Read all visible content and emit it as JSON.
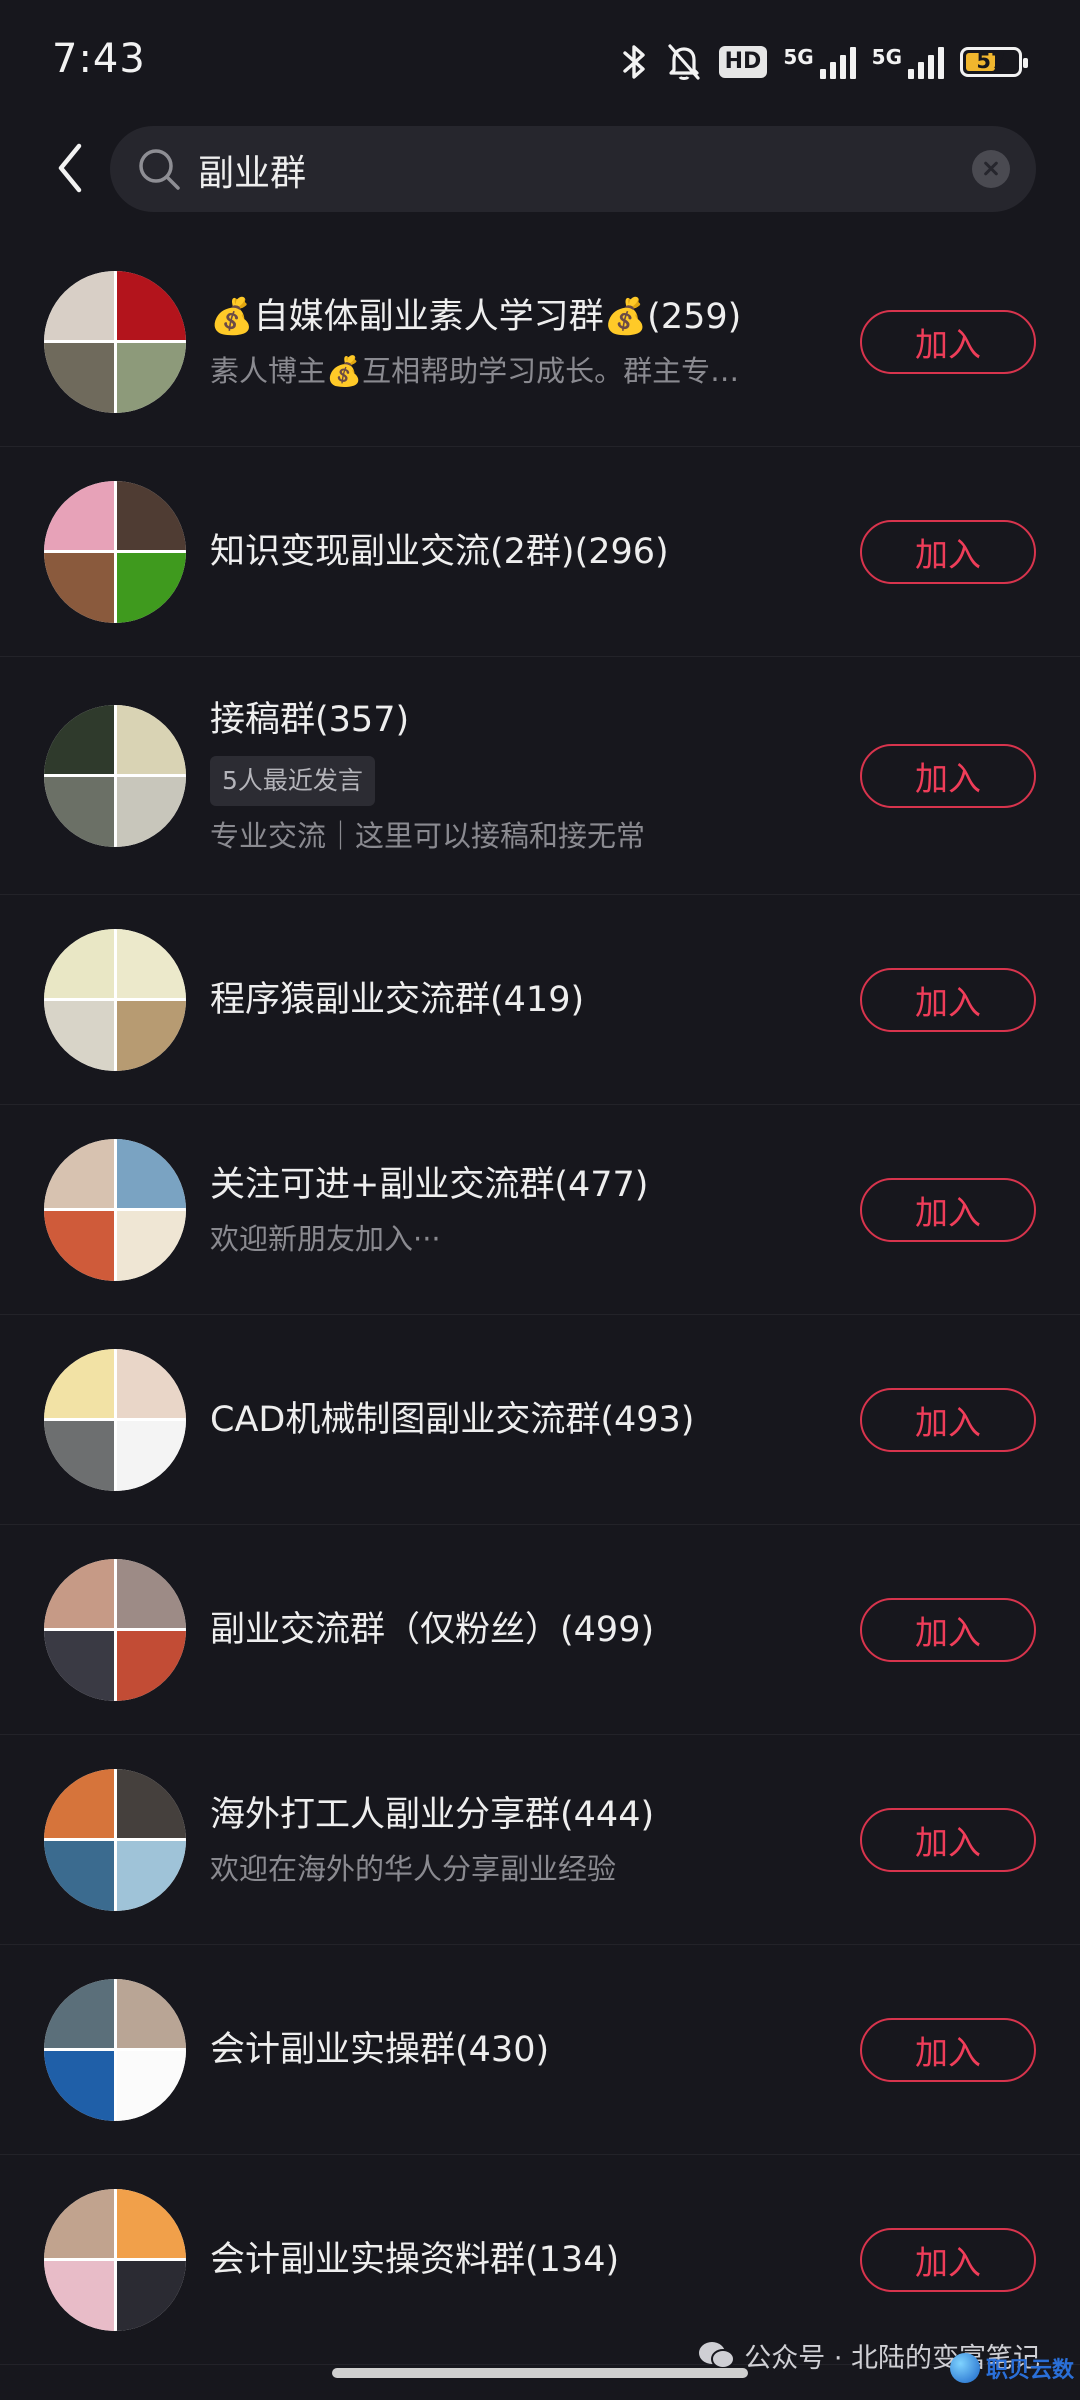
{
  "status_bar": {
    "time": "7:43",
    "network_1": "5G",
    "network_2": "5G",
    "hd_label": "HD",
    "battery": "57",
    "battery_level": 0.57
  },
  "search": {
    "query": "副业群"
  },
  "groups": [
    {
      "title": "💰自媒体副业素人学习群💰(259)",
      "desc": "素人博主💰互相帮助学习成长。群主专…",
      "tag": "",
      "join": "加入",
      "avatar_colors": [
        "#d8cfc6",
        "#b3141c",
        "#6f6a5c",
        "#8d9a7a"
      ]
    },
    {
      "title": "知识变现副业交流(2群)(296)",
      "desc": "",
      "tag": "",
      "join": "加入",
      "avatar_colors": [
        "#e7a2b8",
        "#4f3c33",
        "#8a5a3d",
        "#3f9a1e"
      ]
    },
    {
      "title": "接稿群(357)",
      "tag": "5人最近发言",
      "desc": "专业交流｜这里可以接稿和接无常",
      "join": "加入",
      "avatar_colors": [
        "#2f3a2c",
        "#d9d3b4",
        "#6b7066",
        "#c8c6bb"
      ]
    },
    {
      "title": "程序猿副业交流群(419)",
      "desc": "",
      "tag": "",
      "join": "加入",
      "avatar_colors": [
        "#e9e7c5",
        "#ece9cb",
        "#d8d4c8",
        "#b79b72"
      ]
    },
    {
      "title": "关注可进+副业交流群(477)",
      "desc": "欢迎新朋友加入···",
      "tag": "",
      "join": "加入",
      "avatar_colors": [
        "#d7c2b0",
        "#7aa3c2",
        "#cf5b3a",
        "#efe6d4"
      ]
    },
    {
      "title": "CAD机械制图副业交流群(493)",
      "desc": "",
      "tag": "",
      "join": "加入",
      "avatar_colors": [
        "#f2e2a5",
        "#e9d6c8",
        "#6d6f70",
        "#f4f4f4"
      ]
    },
    {
      "title": "副业交流群（仅粉丝）(499)",
      "desc": "",
      "tag": "",
      "join": "加入",
      "avatar_colors": [
        "#c69a86",
        "#9d8b86",
        "#3a3a44",
        "#c24c35"
      ]
    },
    {
      "title": "海外打工人副业分享群(444)",
      "desc": "欢迎在海外的华人分享副业经验",
      "tag": "",
      "join": "加入",
      "avatar_colors": [
        "#d6743b",
        "#45403d",
        "#3b6b8f",
        "#9fc3d8"
      ]
    },
    {
      "title": "会计副业实操群(430)",
      "desc": "",
      "tag": "",
      "join": "加入",
      "avatar_colors": [
        "#5b6f7a",
        "#b9a595",
        "#1f5fa8",
        "#fbfbfb"
      ]
    },
    {
      "title": "会计副业实操资料群(134)",
      "desc": "",
      "tag": "",
      "join": "加入",
      "avatar_colors": [
        "#c1a38e",
        "#f1a04a",
        "#e8bcc8",
        "#2b2b33"
      ]
    }
  ],
  "footer": {
    "watermark": "公众号 · 北陆的变富笔记",
    "corner_logo": "职贝云数"
  }
}
